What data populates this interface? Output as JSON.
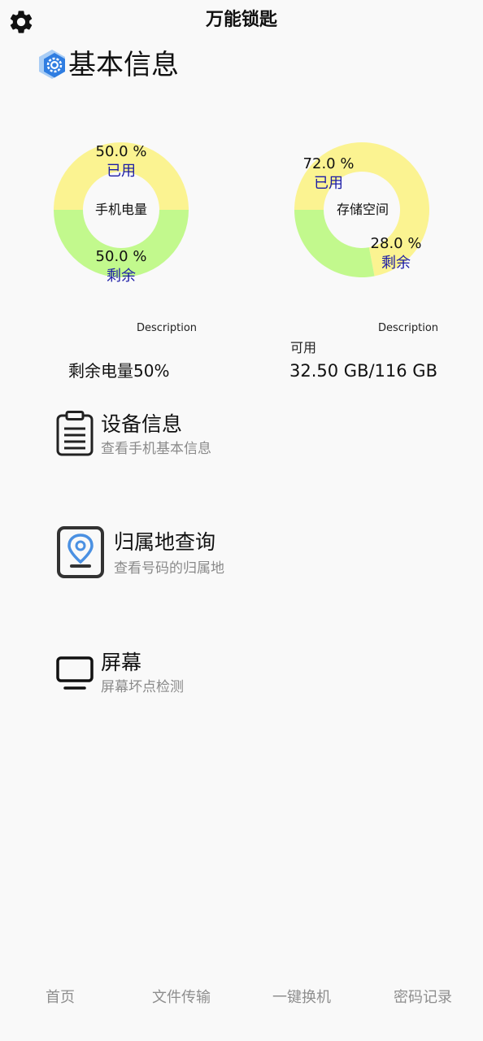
{
  "header": {
    "title": "万能锁匙",
    "settings_icon": "gear-icon"
  },
  "section": {
    "title": "基本信息",
    "icon": "settings-hexagon-icon",
    "icon_color": "#2f7de1"
  },
  "battery_chart": {
    "center_label": "手机电量",
    "used_pct": "50.0 %",
    "used_label": "已用",
    "remain_pct": "50.0 %",
    "remain_label": "剩余",
    "description": "Description",
    "colors": {
      "used": "#fbf391",
      "remaining": "#c2f98d"
    }
  },
  "storage_chart": {
    "center_label": "存储空间",
    "used_pct": "72.0 %",
    "used_label": "已用",
    "remain_pct": "28.0 %",
    "remain_label": "剩余",
    "description": "Description",
    "colors": {
      "used": "#fbf391",
      "remaining": "#c2f98d"
    }
  },
  "chart_data": [
    {
      "type": "pie",
      "center_label": "手机电量",
      "categories": [
        "已用",
        "剩余"
      ],
      "values": [
        50.0,
        50.0
      ],
      "description": "Description"
    },
    {
      "type": "pie",
      "center_label": "存储空间",
      "categories": [
        "已用",
        "剩余"
      ],
      "values": [
        72.0,
        28.0
      ],
      "description": "Description"
    }
  ],
  "battery_info": {
    "text": "剩余电量50%"
  },
  "storage_info": {
    "caption": "可用",
    "value": "32.50 GB/116 GB"
  },
  "features": [
    {
      "title": "设备信息",
      "subtitle": "查看手机基本信息",
      "icon": "clipboard-icon"
    },
    {
      "title": "归属地查询",
      "subtitle": "查看号码的归属地",
      "icon": "location-pin-icon",
      "accent": "#4a90e2"
    },
    {
      "title": "屏幕",
      "subtitle": "屏幕坏点检测",
      "icon": "monitor-icon"
    }
  ],
  "bottom_nav": {
    "items": [
      {
        "label": "首页"
      },
      {
        "label": "文件传输"
      },
      {
        "label": "一键换机"
      },
      {
        "label": "密码记录"
      }
    ]
  }
}
